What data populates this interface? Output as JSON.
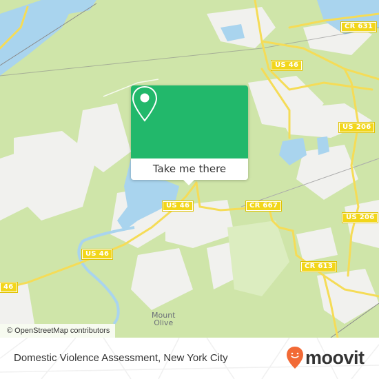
{
  "map": {
    "attribution": "© OpenStreetMap contributors",
    "road_shields": [
      {
        "id": "cr631",
        "label": "CR 631"
      },
      {
        "id": "us46-ne",
        "label": "US 46"
      },
      {
        "id": "us206-n",
        "label": "US 206"
      },
      {
        "id": "us46-center",
        "label": "US 46"
      },
      {
        "id": "cr667",
        "label": "CR 667"
      },
      {
        "id": "us206-s",
        "label": "US 206"
      },
      {
        "id": "us46-w",
        "label": "US 46"
      },
      {
        "id": "cr613",
        "label": "CR 613"
      },
      {
        "id": "us46-edge",
        "label": "46"
      }
    ],
    "places": [
      {
        "id": "mount-olive",
        "line1": "Mount",
        "line2": "Olive"
      }
    ],
    "colors": {
      "land": "#cfe5a9",
      "water": "#a9d4ee",
      "urban": "#f1f1ee",
      "road": "#f5dc57",
      "shield": "#f2d61a"
    }
  },
  "popup": {
    "icon": "map-pin-icon",
    "button_label": "Take me there",
    "color": "#22b86b"
  },
  "footer": {
    "title": "Domestic Violence Assessment, New York City",
    "brand": "moovit",
    "brand_color": "#f26a36"
  }
}
